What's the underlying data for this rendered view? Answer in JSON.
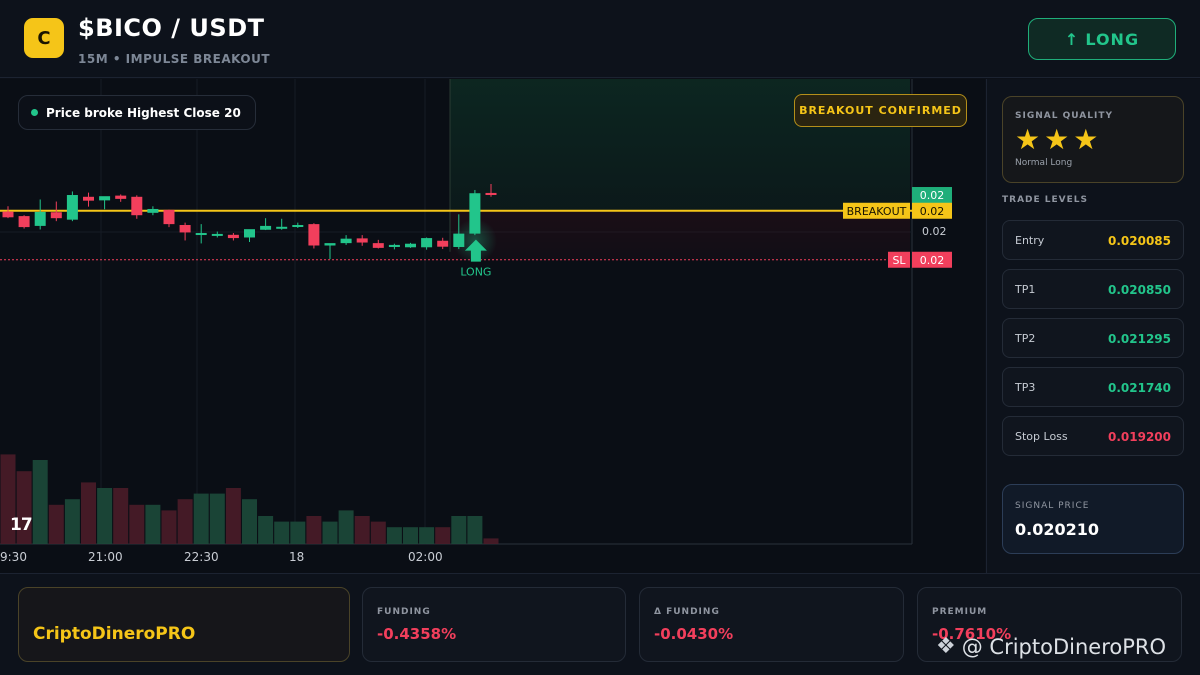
{
  "header": {
    "logo_letter": "C",
    "title": "$BICO / USDT",
    "subtitle": "15M • IMPULSE BREAKOUT",
    "long_button": {
      "icon": "arrow-up-icon",
      "arrow": "↑",
      "label": "LONG"
    }
  },
  "chart": {
    "info_pill": "Price broke Highest Close 20",
    "badge": "BREAKOUT CONFIRMED",
    "tv_logo": "17",
    "x_ticks": [
      "9:30",
      "21:00",
      "22:30",
      "18",
      "02:00"
    ],
    "price_labels": {
      "current": "0.02",
      "breakout_tag": "BREAKOUT",
      "breakout_value": "0.02",
      "last_value": "0.02",
      "sl_tag": "SL",
      "sl_value": "0.02"
    },
    "signal_marker": "LONG",
    "colors": {
      "up": "#22c58b",
      "down": "#f23f5c",
      "breakout": "#f5c518"
    }
  },
  "chart_data": {
    "type": "candlestick",
    "timeframe": "15M",
    "candles": [
      {
        "o": 0.02082,
        "h": 0.021,
        "c": 0.02063,
        "l": 0.0206
      },
      {
        "o": 0.02067,
        "h": 0.0207,
        "c": 0.0203,
        "l": 0.02025
      },
      {
        "o": 0.02034,
        "h": 0.02123,
        "c": 0.02081,
        "l": 0.02022
      },
      {
        "o": 0.0208,
        "h": 0.02116,
        "c": 0.0206,
        "l": 0.0205
      },
      {
        "o": 0.02055,
        "h": 0.0215,
        "c": 0.02138,
        "l": 0.0205
      },
      {
        "o": 0.02132,
        "h": 0.02146,
        "c": 0.02119,
        "l": 0.02099
      },
      {
        "o": 0.0212,
        "h": 0.02128,
        "c": 0.02134,
        "l": 0.0209
      },
      {
        "o": 0.02136,
        "h": 0.0214,
        "c": 0.02125,
        "l": 0.02115
      },
      {
        "o": 0.02132,
        "h": 0.02137,
        "c": 0.0207,
        "l": 0.02058
      },
      {
        "o": 0.02078,
        "h": 0.021,
        "c": 0.02091,
        "l": 0.0207
      },
      {
        "o": 0.02088,
        "h": 0.02089,
        "c": 0.0204,
        "l": 0.0203
      },
      {
        "o": 0.02037,
        "h": 0.02045,
        "c": 0.02012,
        "l": 0.01985
      },
      {
        "o": 0.0201,
        "h": 0.0204,
        "c": 0.0201,
        "l": 0.01975
      },
      {
        "o": 0.02007,
        "h": 0.02015,
        "c": 0.02007,
        "l": 0.01995
      },
      {
        "o": 0.02004,
        "h": 0.0201,
        "c": 0.01993,
        "l": 0.01985
      },
      {
        "o": 0.01995,
        "h": 0.0201,
        "c": 0.02023,
        "l": 0.0198
      },
      {
        "o": 0.02021,
        "h": 0.0206,
        "c": 0.02034,
        "l": 0.0202
      },
      {
        "o": 0.0203,
        "h": 0.02058,
        "c": 0.02031,
        "l": 0.02021
      },
      {
        "o": 0.02032,
        "h": 0.02045,
        "c": 0.02037,
        "l": 0.02027
      },
      {
        "o": 0.0204,
        "h": 0.02043,
        "c": 0.01968,
        "l": 0.01958
      },
      {
        "o": 0.01968,
        "h": 0.0197,
        "c": 0.01976,
        "l": 0.01922
      },
      {
        "o": 0.01976,
        "h": 0.02003,
        "c": 0.01991,
        "l": 0.0197
      },
      {
        "o": 0.01992,
        "h": 0.02003,
        "c": 0.01978,
        "l": 0.01967
      },
      {
        "o": 0.01976,
        "h": 0.01987,
        "c": 0.0196,
        "l": 0.01958
      },
      {
        "o": 0.01963,
        "h": 0.01974,
        "c": 0.0197,
        "l": 0.01955
      },
      {
        "o": 0.01962,
        "h": 0.01977,
        "c": 0.01974,
        "l": 0.0196
      },
      {
        "o": 0.01962,
        "h": 0.01995,
        "c": 0.01993,
        "l": 0.01954
      },
      {
        "o": 0.01984,
        "h": 0.01994,
        "c": 0.01964,
        "l": 0.01956
      },
      {
        "o": 0.01963,
        "h": 0.02073,
        "c": 0.02008,
        "l": 0.01956
      },
      {
        "o": 0.02008,
        "h": 0.02155,
        "c": 0.02144,
        "l": 0.02003
      },
      {
        "o": 0.02145,
        "h": 0.02175,
        "c": 0.02138,
        "l": 0.02132
      }
    ],
    "volume": [
      16,
      13,
      15,
      7,
      8,
      11,
      10,
      10,
      7,
      7,
      6,
      8,
      9,
      9,
      10,
      8,
      5,
      4,
      4,
      5,
      4,
      6,
      5,
      4,
      3,
      3,
      3,
      3,
      5,
      5,
      1
    ],
    "levels": {
      "breakout": 0.02085,
      "stop_loss": 0.0192
    },
    "x_tick_labels": [
      "9:30",
      "21:00",
      "22:30",
      "18",
      "02:00"
    ]
  },
  "sidebar": {
    "quality": {
      "label": "SIGNAL QUALITY",
      "stars": [
        "★",
        "★",
        "★"
      ],
      "rating": 3,
      "sub": "Normal Long"
    },
    "levels_title": "TRADE LEVELS",
    "levels": [
      {
        "name": "Entry",
        "value": "0.020085",
        "color": "#f5c518"
      },
      {
        "name": "TP1",
        "value": "0.020850",
        "color": "#22c58b"
      },
      {
        "name": "TP2",
        "value": "0.021295",
        "color": "#22c58b"
      },
      {
        "name": "TP3",
        "value": "0.021740",
        "color": "#22c58b"
      },
      {
        "name": "Stop Loss",
        "value": "0.019200",
        "color": "#f23f5c"
      }
    ],
    "signal_price": {
      "label": "SIGNAL PRICE",
      "value": "0.020210"
    }
  },
  "bottom": {
    "brand": "CriptoDineroPRO",
    "metrics": [
      {
        "label": "FUNDING",
        "value": "-0.4358%"
      },
      {
        "label": "Δ FUNDING",
        "value": "-0.0430%"
      },
      {
        "label": "PREMIUM",
        "value": "-0.7610%"
      }
    ],
    "watermark": {
      "icon": "binance-icon",
      "glyph": "❖",
      "text": "@ CriptoDineroPRO"
    }
  }
}
